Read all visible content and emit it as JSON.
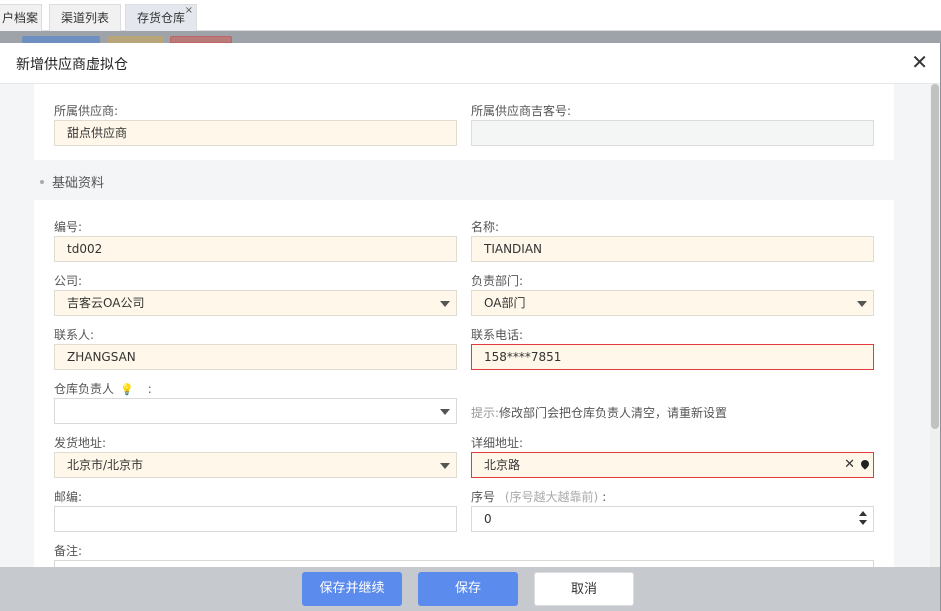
{
  "tabs": [
    {
      "label": "户档案"
    },
    {
      "label": "渠道列表"
    },
    {
      "label": "存货仓库",
      "close": "×"
    }
  ],
  "modal": {
    "title": "新增供应商虚拟仓",
    "close_glyph": "✕"
  },
  "supplier": {
    "supplier_label": "所属供应商:",
    "supplier_value": "甜点供应商",
    "code_label": "所属供应商吉客号:",
    "code_value": ""
  },
  "section": {
    "title": "基础资料"
  },
  "form": {
    "number_label": "编号:",
    "number_value": "td002",
    "name_label": "名称:",
    "name_value": "TIANDIAN",
    "company_label": "公司:",
    "company_value": "吉客云OA公司",
    "dept_label": "负责部门:",
    "dept_value": "OA部门",
    "contact_label": "联系人:",
    "contact_value": "ZHANGSAN",
    "phone_label": "联系电话:",
    "phone_value": "158****7851",
    "manager_label": "仓库负责人",
    "manager_colon": ":",
    "manager_value": "",
    "hint_prefix": "提示:",
    "hint_text": "修改部门会把仓库负责人清空，请重新设置",
    "ship_label": "发货地址:",
    "ship_value": "北京市/北京市",
    "detail_label": "详细地址:",
    "detail_value": "北京路",
    "zip_label": "邮编:",
    "zip_value": "",
    "seq_label": "序号",
    "seq_note": "(序号越大越靠前)",
    "seq_colon": ":",
    "seq_value": "0",
    "remark_label": "备注:"
  },
  "footer": {
    "save_continue": "保存并继续",
    "save": "保存",
    "cancel": "取消"
  },
  "colors": {
    "primary": "#5b8bec",
    "error_border": "#e23b3b",
    "field_bg": "#fff8ea"
  }
}
